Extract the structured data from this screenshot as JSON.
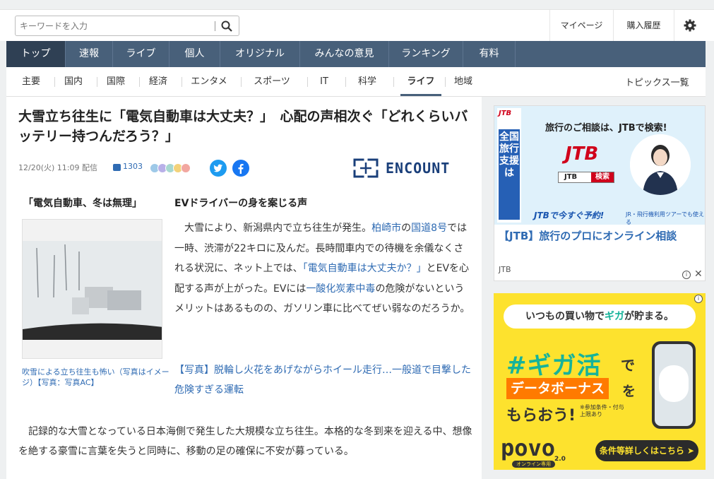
{
  "header": {
    "search_placeholder": "キーワードを入力",
    "mypage": "マイページ",
    "history": "購入履歴"
  },
  "gnav": [
    "トップ",
    "速報",
    "ライブ",
    "個人",
    "オリジナル",
    "みんなの意見",
    "ランキング",
    "有料"
  ],
  "subnav": {
    "items": [
      "主要",
      "国内",
      "国際",
      "経済",
      "エンタメ",
      "スポーツ",
      "IT",
      "科学",
      "ライフ",
      "地域"
    ],
    "active": "ライフ",
    "topics": "トピックス一覧"
  },
  "article": {
    "headline": "大雪立ち往生に「電気自動車は大丈夫？」　心配の声相次ぐ「どれくらいバッテリー持つんだろう？」",
    "date": "12/20(火) 11:09 配信",
    "comment_count": "1303",
    "source": "ENCOUNT",
    "caption_title": "「電気自動車、冬は無理」",
    "photo_caption": "吹雪による立ち往生も怖い（写真はイメージ）【写真：写真AC】",
    "sub_heading": "EVドライバーの身を案じる声",
    "body1": {
      "p1": "　大雪により、新潟県内で立ち往生が発生。",
      "link1": "柏崎市",
      "p2": "の",
      "link2": "国道8号",
      "p3": "では一時、渋滞が22キロに及んだ。長時間車内での待機を余儀なくされる状況に、ネット上では、",
      "link3": "「電気自動車は大丈夫か？」",
      "p4": "とEVを心配する声が上がった。EVには",
      "link4": "一酸化炭素中毒",
      "p5": "の危険がないというメリットはあるものの、ガソリン車に比べてぜい弱なのだろうか。"
    },
    "related": "【写真】脱輪し火花をあげながらホイール走行…一般道で目撃した危険すぎる運転",
    "body2": "　記録的な大雪となっている日本海側で発生した大規模な立ち往生。本格的な冬到来を迎える中、想像を絶する豪雪に言葉を失うと同時に、移動の足の確保に不安が募っている。"
  },
  "ad1": {
    "side_logo": "JTB",
    "side_text": "全国旅行支援は",
    "headline": "旅行のご相談は、JTBで検索!",
    "logo": "JTB",
    "box_label": "JTB",
    "box_button": "検索",
    "cta": "JTBで今すぐ予約!",
    "cta_note": "JR・飛行機利用ツアーでも使える",
    "title": "【JTB】旅行のプロにオンライン相談",
    "source": "JTB"
  },
  "ad2": {
    "top_pre": "いつもの買い物で",
    "top_accent": "ギガ",
    "top_post": "が貯まる。",
    "big": "#ギガ活",
    "de": "で",
    "bonus": "データボーナス",
    "wo": "を",
    "morao": "もらおう!",
    "note": "※参加条件・付与上限あり",
    "brand": "povo",
    "brand_sub": "オンライン専用",
    "version": "2.0",
    "button": "条件等詳しくはこちら ➤"
  },
  "colors": {
    "nav": "#48607a",
    "link": "#2f6bb3",
    "ad2_bg": "#fde22e",
    "jtb_red": "#d0021b"
  }
}
